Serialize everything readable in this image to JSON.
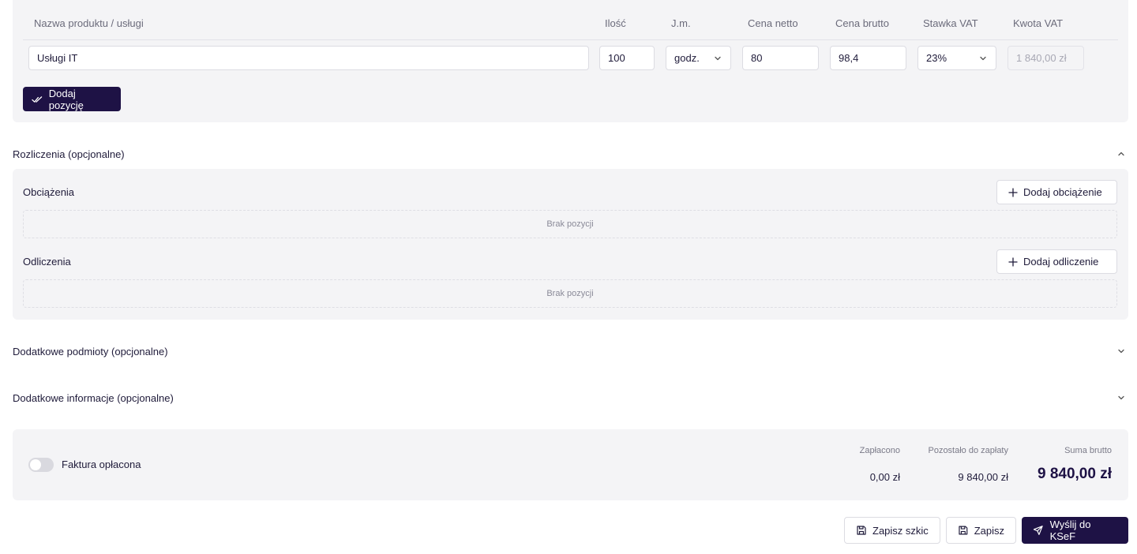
{
  "items": {
    "headers": {
      "name": "Nazwa produktu / usługi",
      "qty": "Ilość",
      "unit": "J.m.",
      "net": "Cena netto",
      "gross": "Cena brutto",
      "vat_rate": "Stawka VAT",
      "vat_amount": "Kwota VAT"
    },
    "row": {
      "name": "Usługi IT",
      "qty": "100",
      "unit": "godz.",
      "net": "80",
      "gross": "98,4",
      "vat_rate": "23%",
      "vat_amount": "1 840,00 zł"
    },
    "add_label": "Dodaj pozycję"
  },
  "settlements": {
    "title": "Rozliczenia (opcjonalne)",
    "charges": {
      "title": "Obciążenia",
      "add_label": "Dodaj obciążenie",
      "empty": "Brak pozycji"
    },
    "deductions": {
      "title": "Odliczenia",
      "add_label": "Dodaj odliczenie",
      "empty": "Brak pozycji"
    }
  },
  "additional_entities": {
    "title": "Dodatkowe podmioty (opcjonalne)"
  },
  "additional_info": {
    "title": "Dodatkowe informacje (opcjonalne)"
  },
  "summary": {
    "paid_toggle_label": "Faktura opłacona",
    "paid_toggle_on": false,
    "paid_label": "Zapłacono",
    "paid_value": "0,00 zł",
    "remaining_label": "Pozostało do zapłaty",
    "remaining_value": "9 840,00 zł",
    "gross_total_label": "Suma brutto",
    "gross_total_value": "9 840,00 zł"
  },
  "footer": {
    "save_draft": "Zapisz szkic",
    "save": "Zapisz",
    "send": "Wyślij do KSeF"
  },
  "colors": {
    "primary": "#1e1245",
    "panel": "#f4f4f6",
    "border": "#dcdce2"
  }
}
